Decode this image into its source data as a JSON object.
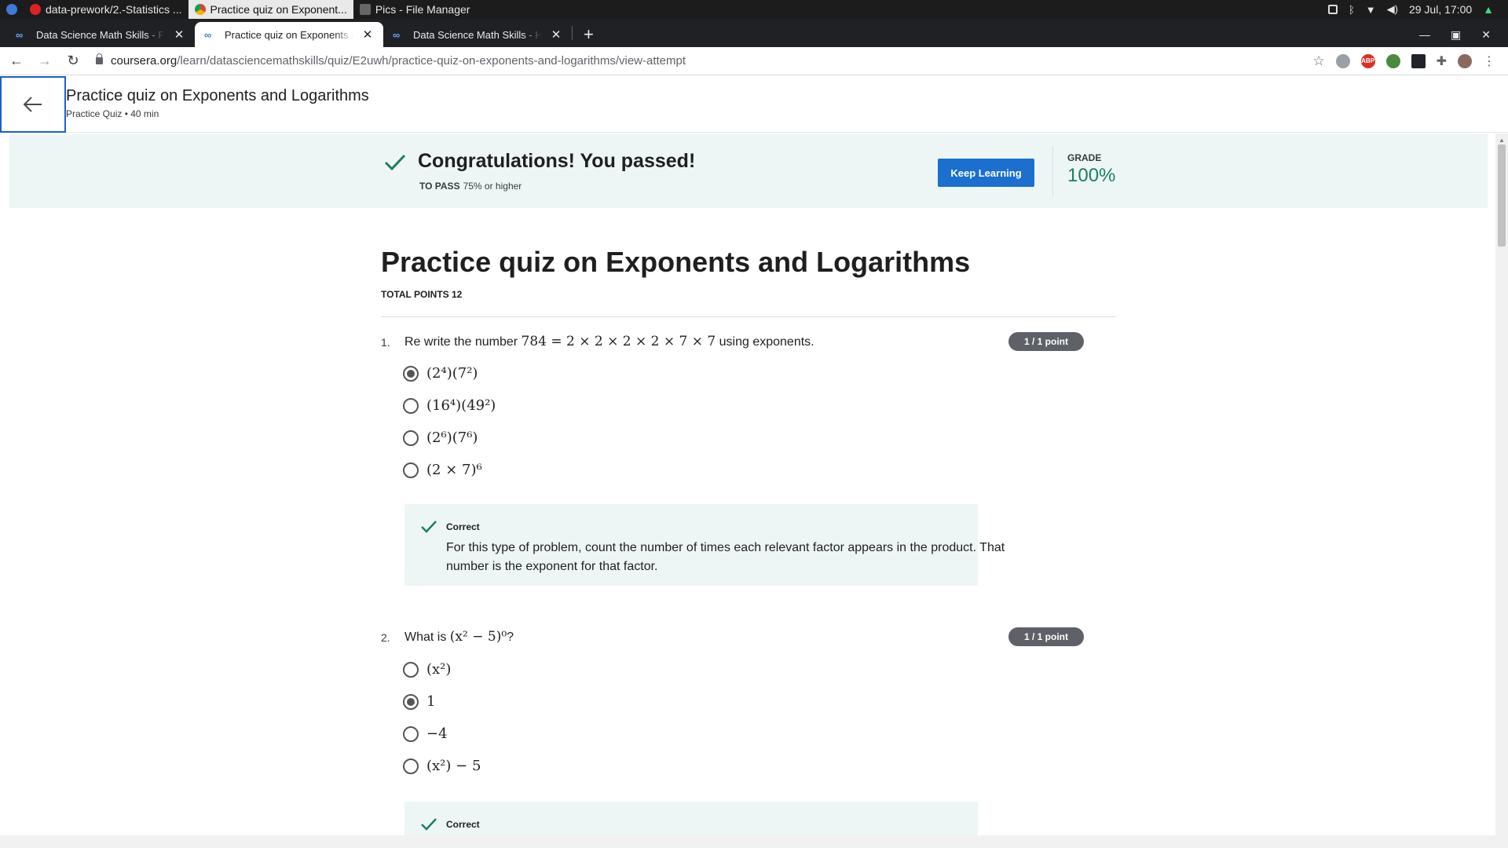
{
  "os": {
    "tasks": [
      {
        "label": "data-prework/2.-Statistics ...",
        "icon": "opera-icon",
        "active": false
      },
      {
        "label": "Practice quiz on Exponent...",
        "icon": "chrome-icon",
        "active": true
      },
      {
        "label": "Pics - File Manager",
        "icon": "folder-icon",
        "active": false
      }
    ],
    "datetime": "29 Jul, 17:00"
  },
  "browser": {
    "tabs": [
      {
        "title": "Data Science Math Skills - Fundamentals",
        "active": false
      },
      {
        "title": "Practice quiz on Exponents and Logarithms",
        "active": true
      },
      {
        "title": "Data Science Math Skills - Home",
        "active": false
      }
    ],
    "url_host": "coursera.org",
    "url_path": "/learn/datasciencemathskills/quiz/E2uwh/practice-quiz-on-exponents-and-logarithms/view-attempt"
  },
  "header": {
    "title": "Practice quiz on Exponents and Logarithms",
    "subtitle": "Practice Quiz • 40 min"
  },
  "banner": {
    "title": "Congratulations! You passed!",
    "to_pass_label": "TO PASS",
    "to_pass_value": "75% or higher",
    "button": "Keep Learning",
    "grade_label": "GRADE",
    "grade_value": "100%"
  },
  "quiz": {
    "title": "Practice quiz on Exponents and Logarithms",
    "total_points": "TOTAL POINTS 12",
    "questions": [
      {
        "number": "1.",
        "text_before": "Re write the number",
        "math": "784 = 2 × 2 × 2 × 2 × 7 × 7",
        "text_after": "using exponents.",
        "points": "1 / 1 point",
        "options": [
          "(2⁴)(7²)",
          "(16⁴)(49²)",
          "(2⁶)(7⁶)",
          "(2 × 7)⁶"
        ],
        "selected": 0,
        "feedback_title": "Correct",
        "feedback_text": "For this type of problem, count the number of times each relevant factor appears in the product. That number is the exponent for that factor."
      },
      {
        "number": "2.",
        "text_before": "What is",
        "math": "(x² − 5)⁰",
        "text_after": "?",
        "points": "1 / 1 point",
        "options": [
          "(x²)",
          "1",
          "−4",
          "(x²) − 5"
        ],
        "selected": 1,
        "feedback_title": "Correct"
      }
    ]
  },
  "colors": {
    "accent": "#1a6fcf",
    "success": "#1a7f64",
    "banner_bg": "#eef6f5"
  }
}
